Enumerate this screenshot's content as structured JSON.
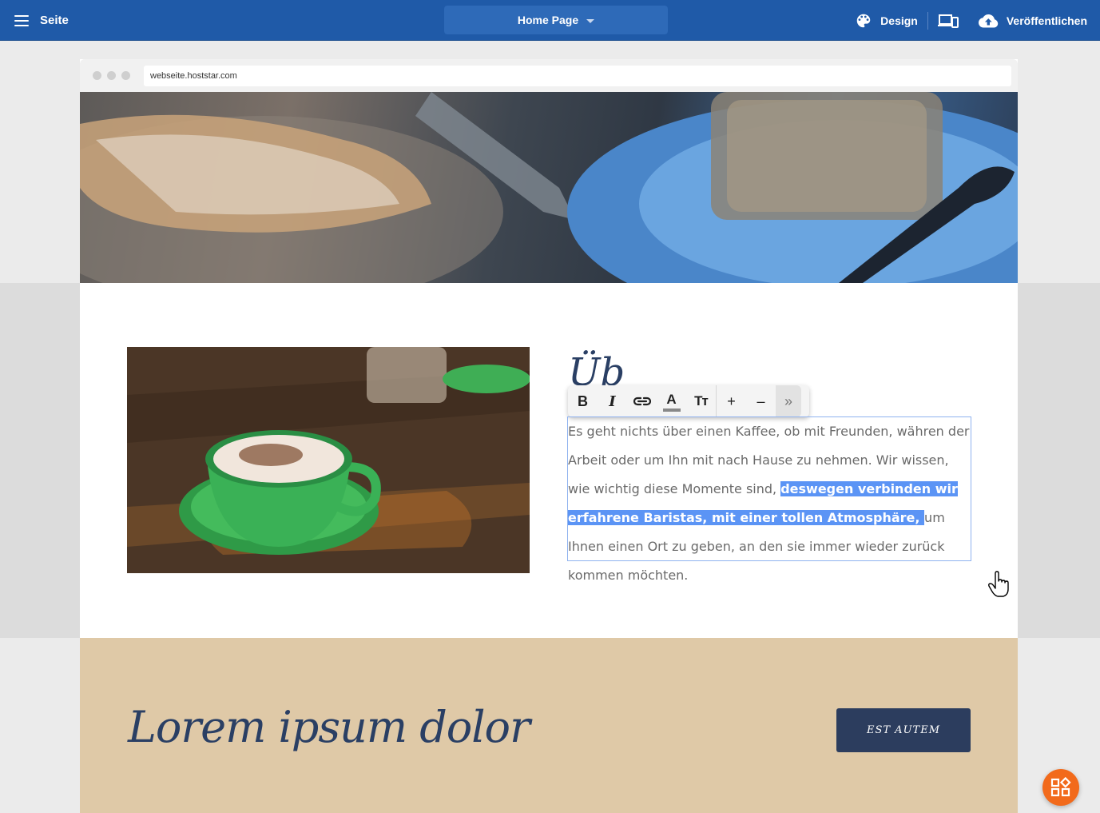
{
  "appbar": {
    "menu_label": "Seite",
    "page_selector": "Home Page",
    "design_label": "Design",
    "publish_label": "Veröffentlichen",
    "bg_color": "#1f5aa8"
  },
  "browser": {
    "url": "webseite.hoststar.com"
  },
  "section": {
    "heading_fragment": "Üb",
    "text_before": "Es geht nichts über einen Kaffee, ob mit Freunden, währen der Arbeit oder um Ihn mit nach Hause zu nehmen. Wir wissen, wie wichtig diese Momente sind, ",
    "text_selected": "deswegen verbinden wir erfahrene Baristas, mit einer tollen Atmosphäre, ",
    "text_after": "um Ihnen einen Ort zu geben, an den sie immer wieder zurück kommen möchten.",
    "selection_color": "#5b94f5"
  },
  "toolbar": {
    "bold": "B",
    "italic": "I",
    "link_icon": "link-icon",
    "text_color": "A",
    "text_size": "Tт",
    "increase": "+",
    "decrease": "–",
    "more": "»"
  },
  "cta": {
    "title": "Lorem ipsum dolor",
    "button_label": "EST AUTEM",
    "band_color": "#dfc9a7",
    "button_color": "#2c3d5e"
  },
  "fab": {
    "icon": "widgets-icon",
    "color": "#f26a1b"
  }
}
